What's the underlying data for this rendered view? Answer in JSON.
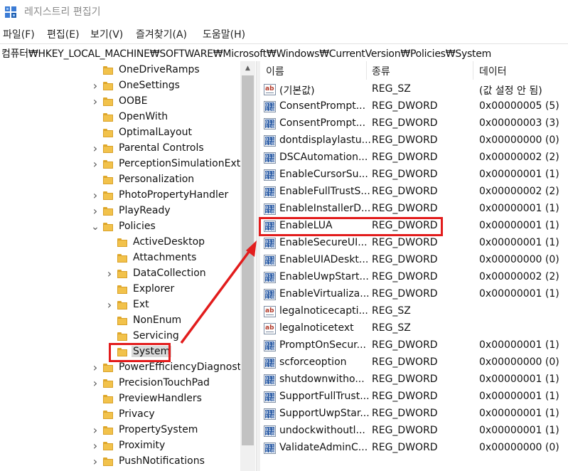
{
  "window": {
    "title": "레지스트리 편집기",
    "icon": "regedit-icon"
  },
  "menu": [
    "파일(F)",
    "편집(E)",
    "보기(V)",
    "즐겨찾기(A)",
    "도움말(H)"
  ],
  "address": "컴퓨터₩HKEY_LOCAL_MACHINE₩SOFTWARE₩Microsoft₩Windows₩CurrentVersion₩Policies₩System",
  "tree": [
    {
      "label": "OneDriveRamps",
      "indent": 0,
      "expander": "none"
    },
    {
      "label": "OneSettings",
      "indent": 0,
      "expander": "collapsed"
    },
    {
      "label": "OOBE",
      "indent": 0,
      "expander": "collapsed"
    },
    {
      "label": "OpenWith",
      "indent": 0,
      "expander": "none"
    },
    {
      "label": "OptimalLayout",
      "indent": 0,
      "expander": "none"
    },
    {
      "label": "Parental Controls",
      "indent": 0,
      "expander": "collapsed"
    },
    {
      "label": "PerceptionSimulationExte",
      "indent": 0,
      "expander": "collapsed"
    },
    {
      "label": "Personalization",
      "indent": 0,
      "expander": "none"
    },
    {
      "label": "PhotoPropertyHandler",
      "indent": 0,
      "expander": "collapsed"
    },
    {
      "label": "PlayReady",
      "indent": 0,
      "expander": "collapsed"
    },
    {
      "label": "Policies",
      "indent": 0,
      "expander": "expanded"
    },
    {
      "label": "ActiveDesktop",
      "indent": 1,
      "expander": "none"
    },
    {
      "label": "Attachments",
      "indent": 1,
      "expander": "none"
    },
    {
      "label": "DataCollection",
      "indent": 1,
      "expander": "collapsed"
    },
    {
      "label": "Explorer",
      "indent": 1,
      "expander": "none"
    },
    {
      "label": "Ext",
      "indent": 1,
      "expander": "collapsed"
    },
    {
      "label": "NonEnum",
      "indent": 1,
      "expander": "none"
    },
    {
      "label": "Servicing",
      "indent": 1,
      "expander": "none"
    },
    {
      "label": "System",
      "indent": 1,
      "expander": "none",
      "selected": true
    },
    {
      "label": "PowerEfficiencyDiagnosti",
      "indent": 0,
      "expander": "collapsed"
    },
    {
      "label": "PrecisionTouchPad",
      "indent": 0,
      "expander": "collapsed"
    },
    {
      "label": "PreviewHandlers",
      "indent": 0,
      "expander": "none"
    },
    {
      "label": "Privacy",
      "indent": 0,
      "expander": "none"
    },
    {
      "label": "PropertySystem",
      "indent": 0,
      "expander": "collapsed"
    },
    {
      "label": "Proximity",
      "indent": 0,
      "expander": "collapsed"
    },
    {
      "label": "PushNotifications",
      "indent": 0,
      "expander": "collapsed"
    }
  ],
  "columns": {
    "name": "이름",
    "type": "종류",
    "data": "데이터"
  },
  "values": [
    {
      "name": "(기본값)",
      "type": "REG_SZ",
      "data": "(값 설정 안 됨)",
      "icon": "sz"
    },
    {
      "name": "ConsentPrompt...",
      "type": "REG_DWORD",
      "data": "0x00000005 (5)",
      "icon": "dw"
    },
    {
      "name": "ConsentPrompt...",
      "type": "REG_DWORD",
      "data": "0x00000003 (3)",
      "icon": "dw"
    },
    {
      "name": "dontdisplaylastu...",
      "type": "REG_DWORD",
      "data": "0x00000000 (0)",
      "icon": "dw"
    },
    {
      "name": "DSCAutomation...",
      "type": "REG_DWORD",
      "data": "0x00000002 (2)",
      "icon": "dw"
    },
    {
      "name": "EnableCursorSu...",
      "type": "REG_DWORD",
      "data": "0x00000001 (1)",
      "icon": "dw"
    },
    {
      "name": "EnableFullTrustS...",
      "type": "REG_DWORD",
      "data": "0x00000002 (2)",
      "icon": "dw"
    },
    {
      "name": "EnableInstallerD...",
      "type": "REG_DWORD",
      "data": "0x00000001 (1)",
      "icon": "dw"
    },
    {
      "name": "EnableLUA",
      "type": "REG_DWORD",
      "data": "0x00000001 (1)",
      "icon": "dw",
      "highlighted": true
    },
    {
      "name": "EnableSecureUI...",
      "type": "REG_DWORD",
      "data": "0x00000001 (1)",
      "icon": "dw"
    },
    {
      "name": "EnableUIADeskt...",
      "type": "REG_DWORD",
      "data": "0x00000000 (0)",
      "icon": "dw"
    },
    {
      "name": "EnableUwpStart...",
      "type": "REG_DWORD",
      "data": "0x00000002 (2)",
      "icon": "dw"
    },
    {
      "name": "EnableVirtualiza...",
      "type": "REG_DWORD",
      "data": "0x00000001 (1)",
      "icon": "dw"
    },
    {
      "name": "legalnoticecapti...",
      "type": "REG_SZ",
      "data": "",
      "icon": "sz"
    },
    {
      "name": "legalnoticetext",
      "type": "REG_SZ",
      "data": "",
      "icon": "sz"
    },
    {
      "name": "PromptOnSecur...",
      "type": "REG_DWORD",
      "data": "0x00000001 (1)",
      "icon": "dw"
    },
    {
      "name": "scforceoption",
      "type": "REG_DWORD",
      "data": "0x00000000 (0)",
      "icon": "dw"
    },
    {
      "name": "shutdownwitho...",
      "type": "REG_DWORD",
      "data": "0x00000001 (1)",
      "icon": "dw"
    },
    {
      "name": "SupportFullTrust...",
      "type": "REG_DWORD",
      "data": "0x00000001 (1)",
      "icon": "dw"
    },
    {
      "name": "SupportUwpStar...",
      "type": "REG_DWORD",
      "data": "0x00000001 (1)",
      "icon": "dw"
    },
    {
      "name": "undockwithoutl...",
      "type": "REG_DWORD",
      "data": "0x00000001 (1)",
      "icon": "dw"
    },
    {
      "name": "ValidateAdminC...",
      "type": "REG_DWORD",
      "data": "0x00000000 (0)",
      "icon": "dw"
    }
  ],
  "annotation": {
    "color": "#e21c1c"
  }
}
